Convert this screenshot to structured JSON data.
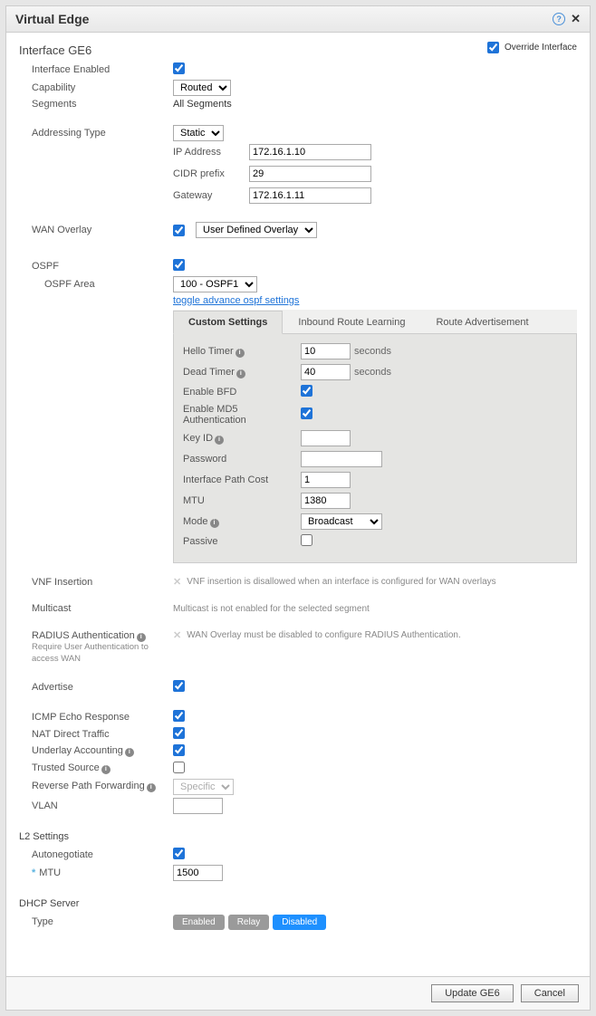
{
  "titlebar": {
    "title": "Virtual Edge"
  },
  "override": {
    "label": "Override Interface",
    "checked": true
  },
  "header": {
    "interface": "Interface GE6"
  },
  "rows": {
    "interface_enabled": "Interface Enabled",
    "capability": "Capability",
    "capability_value": "Routed",
    "segments": "Segments",
    "segments_value": "All Segments",
    "addressing_type": "Addressing Type",
    "addressing_value": "Static",
    "ip_address_label": "IP Address",
    "ip_address": "172.16.1.10",
    "cidr_label": "CIDR prefix",
    "cidr": "29",
    "gateway_label": "Gateway",
    "gateway": "172.16.1.11",
    "wan_overlay": "WAN Overlay",
    "wan_overlay_value": "User Defined Overlay",
    "ospf": "OSPF",
    "ospf_area": "OSPF Area",
    "ospf_area_value": "100 - OSPF1",
    "toggle_link": "toggle advance ospf settings",
    "vnf_insertion": "VNF Insertion",
    "vnf_msg": "VNF insertion is disallowed when an interface is configured for WAN overlays",
    "multicast": "Multicast",
    "multicast_msg": "Multicast is not enabled for the selected segment",
    "radius": "RADIUS Authentication",
    "radius_note": "Require User Authentication to access WAN",
    "radius_msg": "WAN Overlay must be disabled to configure RADIUS Authentication.",
    "advertise": "Advertise",
    "icmp": "ICMP Echo Response",
    "nat": "NAT Direct Traffic",
    "underlay": "Underlay Accounting",
    "trusted": "Trusted Source",
    "rpf": "Reverse Path Forwarding",
    "rpf_value": "Specific",
    "vlan": "VLAN",
    "l2": "L2 Settings",
    "autoneg": "Autonegotiate",
    "mtu": "MTU",
    "mtu_value": "1500",
    "dhcp": "DHCP Server",
    "type": "Type",
    "enabled_btn": "Enabled",
    "relay_btn": "Relay",
    "disabled_btn": "Disabled"
  },
  "tabs": {
    "custom": "Custom Settings",
    "inbound": "Inbound Route Learning",
    "route_adv": "Route Advertisement"
  },
  "ospf_panel": {
    "hello": "Hello Timer",
    "hello_val": "10",
    "dead": "Dead Timer",
    "dead_val": "40",
    "seconds": "seconds",
    "bfd": "Enable BFD",
    "md5": "Enable MD5 Authentication",
    "keyid": "Key ID",
    "password": "Password",
    "path_cost": "Interface Path Cost",
    "path_cost_val": "1",
    "mtu": "MTU",
    "mtu_val": "1380",
    "mode": "Mode",
    "mode_val": "Broadcast",
    "passive": "Passive"
  },
  "footer": {
    "update": "Update GE6",
    "cancel": "Cancel"
  }
}
